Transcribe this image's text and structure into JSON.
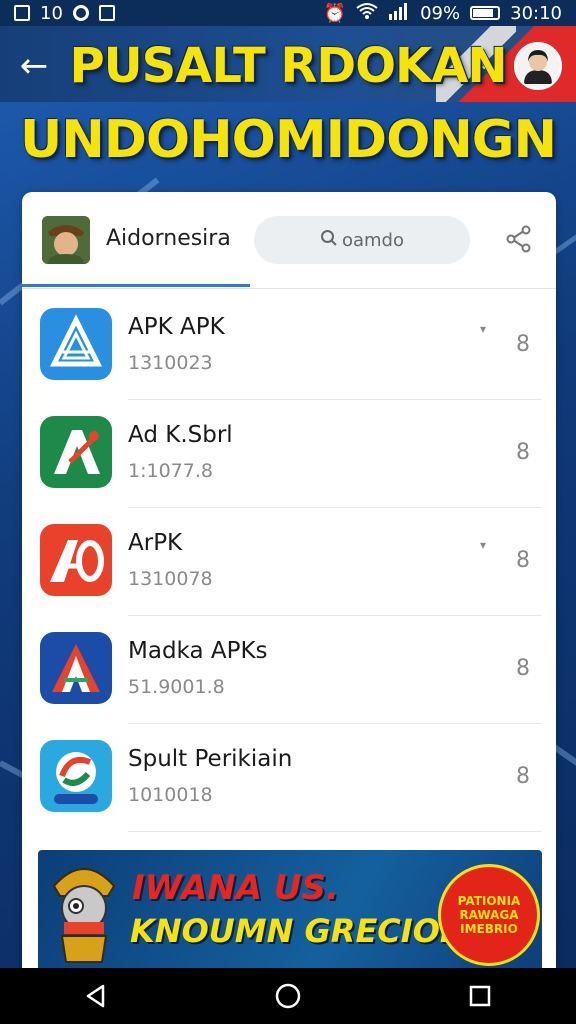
{
  "status_bar": {
    "left_text": "10",
    "battery_text": "09%",
    "time": "30:10"
  },
  "header": {
    "title_line1": "PUSALT RDOKAN",
    "title_line2": "UNDOHOMIDONGN"
  },
  "profile": {
    "name": "Aidornesira"
  },
  "search": {
    "placeholder": "oamdo"
  },
  "apps": [
    {
      "title": "APK APK",
      "subtitle": "1310023",
      "mark": "▾",
      "icon_color": "#2a8fe0"
    },
    {
      "title": "Ad K.Sbrl",
      "subtitle": "1:1077.8",
      "mark": "",
      "icon_color": "#1e8a4a"
    },
    {
      "title": "ArPK",
      "subtitle": "1310078",
      "mark": "▾",
      "icon_color": "#e8432a"
    },
    {
      "title": "Madka APKs",
      "subtitle": "51.9001.8",
      "mark": "",
      "icon_color": "#1a4ca8"
    },
    {
      "title": "Spult Perikiain",
      "subtitle": "1010018",
      "mark": "",
      "icon_color": "#2aa8e0"
    }
  ],
  "row_menu_label": "8",
  "banner": {
    "line1": "IWANA US.",
    "line2": "KNOUMN GRECIOH!",
    "badge_text": "PATIONIA RAWAGA IMEBRIO"
  },
  "colors": {
    "accent": "#2a7ad8",
    "title_yellow": "#f6e30a",
    "header_blue": "#163f78"
  }
}
